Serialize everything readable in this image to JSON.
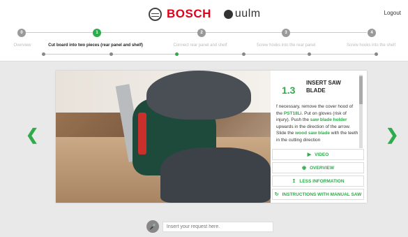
{
  "header": {
    "brand_name": "BOSCH",
    "partner_name": "uulm",
    "logout_label": "Logout"
  },
  "steps": [
    {
      "number": "0",
      "label": "Overview",
      "active": false
    },
    {
      "number": "1",
      "label": "Cut board into two pieces (rear panel and shelf)",
      "active": true
    },
    {
      "number": "2",
      "label": "Connect rear panel and shelf",
      "active": false
    },
    {
      "number": "3",
      "label": "Screw hooks into the rear panel",
      "active": false
    },
    {
      "number": "4",
      "label": "Screw hooks into the shelf",
      "active": false
    }
  ],
  "instruction": {
    "step_number": "1.3",
    "title": "INSERT SAW BLADE",
    "text": [
      {
        "t": "f necessary, remove the cover hood ",
        "hl": false
      },
      {
        "t": "of the ",
        "hl": false
      },
      {
        "t": "PST18Li",
        "hl": true
      },
      {
        "t": ". Put on gloves (risk of injury). Push the ",
        "hl": false
      },
      {
        "t": "saw blade holder",
        "hl": true
      },
      {
        "t": " upwards in the direction of the arrow. Slide the ",
        "hl": false
      },
      {
        "t": "wood saw blade",
        "hl": true
      },
      {
        "t": " with the teeth in the cutting direction",
        "hl": false
      }
    ]
  },
  "actions": {
    "video": "VIDEO",
    "overview": "OVERVIEW",
    "less_info": "LESS INFORMATION",
    "manual_saw": "INSTRUCTIONS WITH MANUAL SAW"
  },
  "query": {
    "placeholder": "Insert your request here."
  },
  "colors": {
    "accent": "#2eab4a",
    "brand": "#e2001a"
  }
}
